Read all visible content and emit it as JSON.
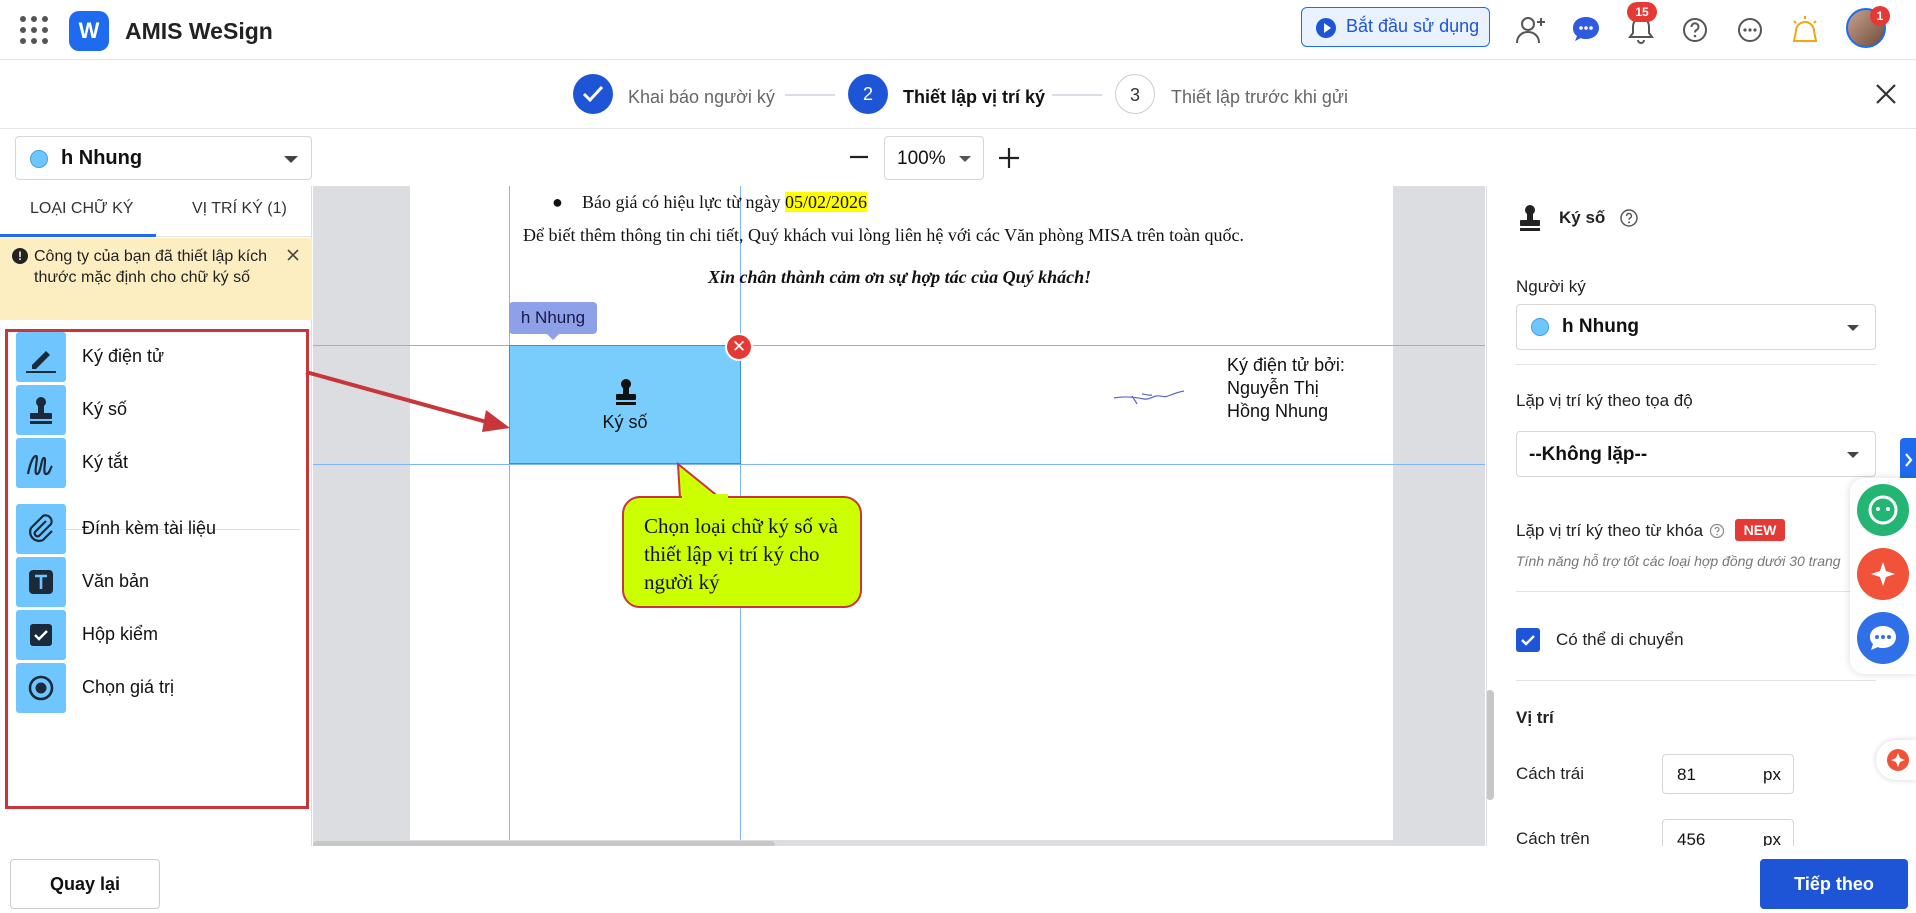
{
  "app": {
    "title": "AMIS WeSign",
    "logo_letter": "W"
  },
  "header": {
    "start_label": "Bắt đầu sử dụng",
    "notification_count": "15",
    "avatar_badge": "1"
  },
  "stepper": {
    "steps": [
      {
        "number": "",
        "label": "Khai báo người ký",
        "state": "done"
      },
      {
        "number": "2",
        "label": "Thiết lập vị trí ký",
        "state": "active"
      },
      {
        "number": "3",
        "label": "Thiết lập trước khi gửi",
        "state": "pending"
      }
    ]
  },
  "toolbar": {
    "signer": "h Nhung",
    "zoom": "100%"
  },
  "left_panel": {
    "tabs": [
      {
        "label": "LOẠI CHỮ KÝ"
      },
      {
        "label": "VỊ TRÍ KÝ (1)"
      }
    ],
    "notice": "Công ty của bạn đã thiết lập kích thước mặc định cho chữ ký số",
    "types": [
      {
        "label": "Ký điện tử",
        "icon": "pen-sign-icon"
      },
      {
        "label": "Ký số",
        "icon": "stamp-icon"
      },
      {
        "label": "Ký tắt",
        "icon": "initials-icon"
      },
      {
        "label": "Đính kèm tài liệu",
        "icon": "paperclip-icon"
      },
      {
        "label": "Văn bản",
        "icon": "text-icon"
      },
      {
        "label": "Hộp kiểm",
        "icon": "checkbox-icon"
      },
      {
        "label": "Chọn giá trị",
        "icon": "radio-icon"
      }
    ]
  },
  "document": {
    "bullet_prefix": "Báo giá có hiệu lực từ ngày ",
    "bullet_date": "05/02/2026",
    "info_line": "Để biết thêm thông tin chi tiết, Quý khách vui lòng liên hệ với các Văn phòng MISA trên toàn quốc.",
    "thanks_line": "Xin chân thành cảm ơn sự hợp tác của Quý khách!",
    "esign_text": "Ký điện tử bởi: Nguyễn Thị Hồng Nhung",
    "sig_tag": "h Nhung",
    "sig_box_label": "Ký số",
    "callout": "Chọn loại chữ ký số và thiết lập vị trí ký cho người ký"
  },
  "right_panel": {
    "title": "Ký số",
    "signer_label": "Người ký",
    "signer_value": "h Nhung",
    "repeat_coord_label": "Lặp vị trí ký theo tọa độ",
    "repeat_coord_value": "--Không lặp--",
    "repeat_keyword_label": "Lặp vị trí ký theo từ khóa",
    "new_badge": "NEW",
    "keyword_note": "Tính năng hỗ trợ tốt các loại hợp đồng dưới 30 trang",
    "movable_label": "Có thể di chuyển",
    "position_title": "Vị trí",
    "left_label": "Cách trái",
    "left_value": "81",
    "top_label": "Cách trên",
    "top_value": "456",
    "unit": "px"
  },
  "footer": {
    "back_label": "Quay lại",
    "next_label": "Tiếp theo"
  },
  "colors": {
    "primary": "#1e55d6",
    "signature_fill": "#79cdfd",
    "callout_fill": "#ccff00",
    "alert_red": "#c8353a",
    "notice_bg": "#fdeec2"
  }
}
